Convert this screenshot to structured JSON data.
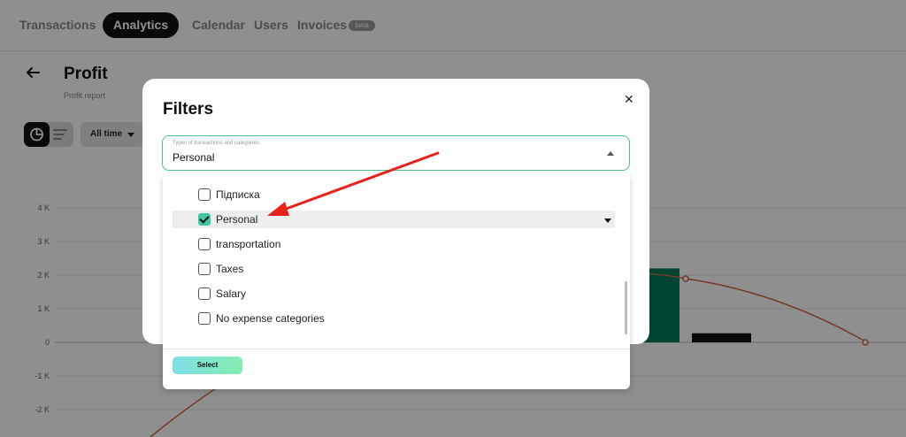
{
  "nav": {
    "tabs": [
      "Transactions",
      "Analytics",
      "Calendar",
      "Users",
      "Invoices"
    ],
    "active_tab": "Analytics",
    "invoices_badge": "beta"
  },
  "page": {
    "title": "Profit",
    "subtitle": "Profit report",
    "period_label": "All time"
  },
  "chart_data": {
    "type": "bar",
    "y_tick_labels": [
      "4 K",
      "3 K",
      "2 K",
      "1 K",
      "0",
      "-1 K",
      "-2 K"
    ],
    "ylim": [
      -2800,
      4500
    ],
    "visible_bars": [
      {
        "color": "#00795a",
        "value": 2200
      },
      {
        "color": "#111111",
        "value": 270
      }
    ],
    "trend_line_color": "#c9684a",
    "grid": true
  },
  "modal": {
    "title": "Filters",
    "close_icon": "close-icon",
    "select": {
      "label": "Types of transactions and categories",
      "value": "Personal"
    },
    "options": [
      {
        "label": "Підписка",
        "checked": false
      },
      {
        "label": "Personal",
        "checked": true
      },
      {
        "label": "transportation",
        "checked": false
      },
      {
        "label": "Taxes",
        "checked": false
      },
      {
        "label": "Salary",
        "checked": false
      },
      {
        "label": "No expense categories",
        "checked": false
      }
    ],
    "select_button": "Select"
  },
  "colors": {
    "accent_green": "#4cc38a",
    "checkbox_checked": "#3ec8a2",
    "annotation_arrow": "#e8221b"
  }
}
